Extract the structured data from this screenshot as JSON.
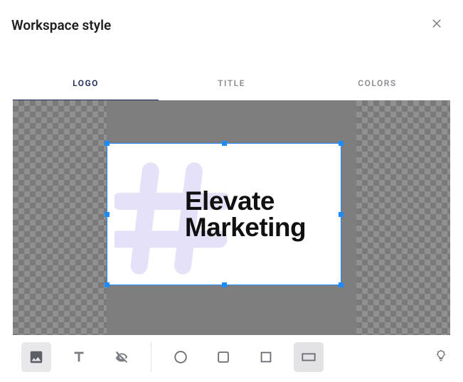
{
  "header": {
    "title": "Workspace style"
  },
  "tabs": [
    {
      "label": "LOGO",
      "active": true
    },
    {
      "label": "TITLE",
      "active": false
    },
    {
      "label": "COLORS",
      "active": false
    }
  ],
  "logo": {
    "line1": "Elevate",
    "line2": "Marketing",
    "hash_color": "#cfcaf5"
  },
  "tools": {
    "image": {
      "name": "image-tool",
      "active": true
    },
    "text": {
      "name": "text-tool",
      "active": false
    },
    "hide": {
      "name": "visibility-off",
      "active": false
    },
    "circle": {
      "name": "shape-circle",
      "active": false
    },
    "square": {
      "name": "shape-square",
      "active": false
    },
    "squareAlt": {
      "name": "shape-square-alt",
      "active": false
    },
    "rect": {
      "name": "shape-rectangle",
      "active": true
    }
  }
}
